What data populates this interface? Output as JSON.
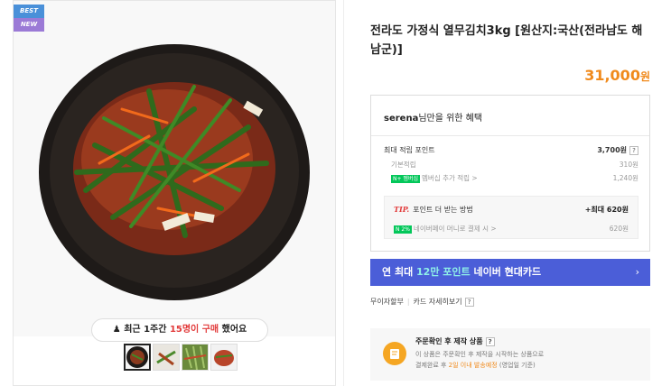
{
  "badges": {
    "best": "BEST",
    "new": "NEW"
  },
  "viewer": {
    "prefix": "최근 ",
    "period": "1주간 ",
    "count": "15명이 구매",
    "suffix": " 했어요"
  },
  "thumbnails": [
    "thumb-1",
    "thumb-2",
    "thumb-3",
    "thumb-4"
  ],
  "product": {
    "title": "전라도 가정식 열무김치3kg [원산지:국산(전라남도 해남군)]",
    "price": "31,000",
    "currency": "원"
  },
  "benefit": {
    "user": "serena",
    "title_suffix": "님만을 위한 혜택",
    "max_points_label": "최대 적립 포인트",
    "max_points_value": "3,700원",
    "basic_label": "기본적립",
    "basic_value": "310원",
    "membership_tag": "N+ 멤버십",
    "membership_label": "멤버십 추가 적립 >",
    "membership_value": "1,240원",
    "tip_label": "TIP.",
    "tip_text": "포인트 더 받는 방법",
    "tip_max": "+최대 620원",
    "naverpay_tag": "N 2%",
    "naverpay_label": "네이버페이 머니로 결제 시 >",
    "naverpay_value": "620원"
  },
  "card_banner": {
    "prefix": "연 최대 ",
    "highlight": "12만 포인트",
    "suffix": " 네이버 현대카드",
    "chevron": "›"
  },
  "installment": {
    "label": "무이자할부",
    "card_label": "카드 자세히보기"
  },
  "order": {
    "title": "주문확인 후 제작 상품",
    "desc1": "이 상품은 주문확인 후 제작을 시작하는 상품으로",
    "desc2_prefix": "결제완료 후 ",
    "desc2_highlight": "2일 이내 발송예정",
    "desc2_suffix": " (영업일 기준)"
  },
  "colors": {
    "price": "#f08a1c",
    "banner": "#4b5ed8",
    "banner_highlight": "#8ff0e8",
    "alert": "#e23b3b"
  }
}
